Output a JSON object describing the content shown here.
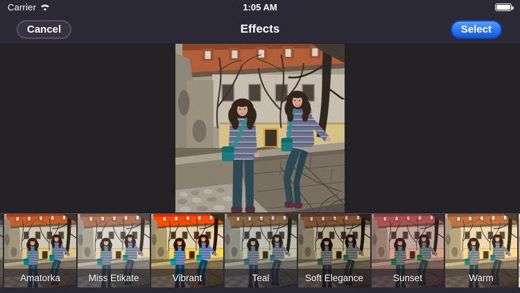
{
  "status_bar": {
    "carrier": "Carrier",
    "time": "1:05 AM",
    "battery_level": "full"
  },
  "nav_bar": {
    "cancel_label": "Cancel",
    "title": "Effects",
    "select_label": "Select"
  },
  "colors": {
    "chrome_background": "#2c2936",
    "stage_background": "#232126",
    "select_button_blue": "#2f7cf6"
  },
  "filters": [
    "Amatorka",
    "Miss Etikate",
    "Vibrant",
    "Teal",
    "Soft Elegance",
    "Sunset",
    "Warm"
  ]
}
